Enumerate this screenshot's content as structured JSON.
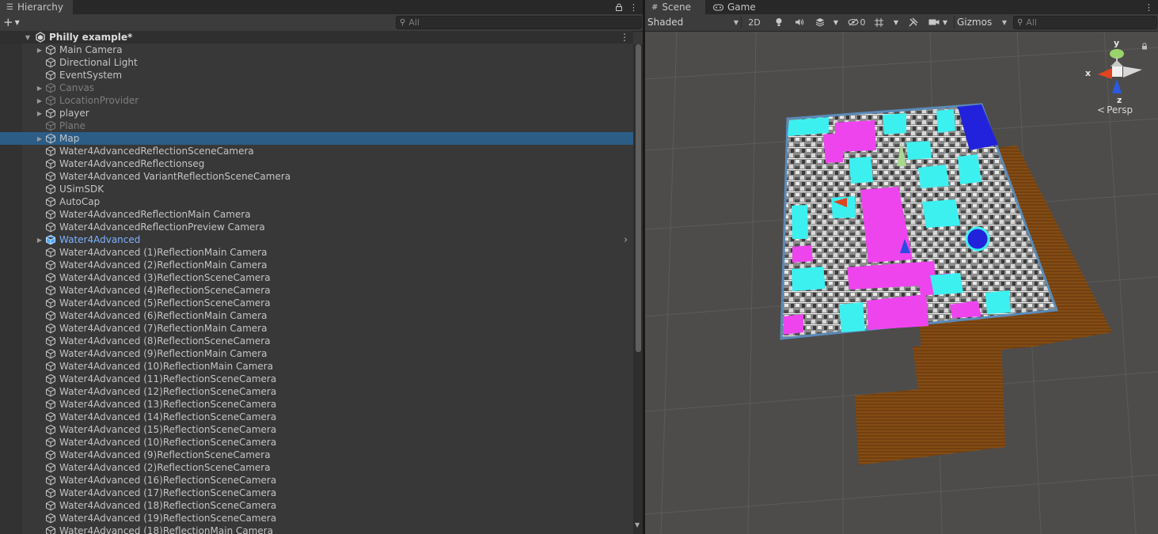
{
  "hierarchy": {
    "tab_title": "Hierarchy",
    "search_placeholder": "All",
    "scene_name": "Philly example*",
    "items": [
      {
        "label": "Main Camera",
        "fold": true,
        "state": "normal"
      },
      {
        "label": "Directional Light",
        "fold": false,
        "state": "normal"
      },
      {
        "label": "EventSystem",
        "fold": false,
        "state": "normal"
      },
      {
        "label": "Canvas",
        "fold": true,
        "state": "dim"
      },
      {
        "label": "LocationProvider",
        "fold": true,
        "state": "dim"
      },
      {
        "label": "player",
        "fold": true,
        "state": "normal"
      },
      {
        "label": "Plane",
        "fold": false,
        "state": "dim"
      },
      {
        "label": "Map",
        "fold": true,
        "state": "selected"
      },
      {
        "label": "Water4AdvancedReflectionSceneCamera",
        "fold": false,
        "state": "normal"
      },
      {
        "label": "Water4AdvancedReflectionseg",
        "fold": false,
        "state": "normal"
      },
      {
        "label": "Water4Advanced VariantReflectionSceneCamera",
        "fold": false,
        "state": "normal"
      },
      {
        "label": "USimSDK",
        "fold": false,
        "state": "normal"
      },
      {
        "label": "AutoCap",
        "fold": false,
        "state": "normal"
      },
      {
        "label": "Water4AdvancedReflectionMain Camera",
        "fold": false,
        "state": "normal"
      },
      {
        "label": "Water4AdvancedReflectionPreview Camera",
        "fold": false,
        "state": "normal"
      },
      {
        "label": "Water4Advanced",
        "fold": true,
        "state": "prefab"
      },
      {
        "label": "Water4Advanced (1)ReflectionMain Camera",
        "fold": false,
        "state": "normal"
      },
      {
        "label": "Water4Advanced (2)ReflectionMain Camera",
        "fold": false,
        "state": "normal"
      },
      {
        "label": "Water4Advanced (3)ReflectionSceneCamera",
        "fold": false,
        "state": "normal"
      },
      {
        "label": "Water4Advanced (4)ReflectionSceneCamera",
        "fold": false,
        "state": "normal"
      },
      {
        "label": "Water4Advanced (5)ReflectionSceneCamera",
        "fold": false,
        "state": "normal"
      },
      {
        "label": "Water4Advanced (6)ReflectionMain Camera",
        "fold": false,
        "state": "normal"
      },
      {
        "label": "Water4Advanced (7)ReflectionMain Camera",
        "fold": false,
        "state": "normal"
      },
      {
        "label": "Water4Advanced (8)ReflectionSceneCamera",
        "fold": false,
        "state": "normal"
      },
      {
        "label": "Water4Advanced (9)ReflectionMain Camera",
        "fold": false,
        "state": "normal"
      },
      {
        "label": "Water4Advanced (10)ReflectionMain Camera",
        "fold": false,
        "state": "normal"
      },
      {
        "label": "Water4Advanced (11)ReflectionSceneCamera",
        "fold": false,
        "state": "normal"
      },
      {
        "label": "Water4Advanced (12)ReflectionSceneCamera",
        "fold": false,
        "state": "normal"
      },
      {
        "label": "Water4Advanced (13)ReflectionSceneCamera",
        "fold": false,
        "state": "normal"
      },
      {
        "label": "Water4Advanced (14)ReflectionSceneCamera",
        "fold": false,
        "state": "normal"
      },
      {
        "label": "Water4Advanced (15)ReflectionSceneCamera",
        "fold": false,
        "state": "normal"
      },
      {
        "label": "Water4Advanced (10)ReflectionSceneCamera",
        "fold": false,
        "state": "normal"
      },
      {
        "label": "Water4Advanced (9)ReflectionSceneCamera",
        "fold": false,
        "state": "normal"
      },
      {
        "label": "Water4Advanced (2)ReflectionSceneCamera",
        "fold": false,
        "state": "normal"
      },
      {
        "label": "Water4Advanced (16)ReflectionSceneCamera",
        "fold": false,
        "state": "normal"
      },
      {
        "label": "Water4Advanced (17)ReflectionSceneCamera",
        "fold": false,
        "state": "normal"
      },
      {
        "label": "Water4Advanced (18)ReflectionSceneCamera",
        "fold": false,
        "state": "normal"
      },
      {
        "label": "Water4Advanced (19)ReflectionSceneCamera",
        "fold": false,
        "state": "normal"
      },
      {
        "label": "Water4Advanced (18)ReflectionMain Camera",
        "fold": false,
        "state": "normal"
      }
    ]
  },
  "scene": {
    "tabs": [
      {
        "label": "Scene",
        "icon": "grid-icon"
      },
      {
        "label": "Game",
        "icon": "gamepad-icon"
      }
    ],
    "shading_mode": "Shaded",
    "mode_2d": "2D",
    "hidden_count": "0",
    "gizmos_label": "Gizmos",
    "search_placeholder": "All",
    "axis_labels": {
      "y": "y",
      "x": "x",
      "z": "z"
    },
    "projection_label": "Persp"
  },
  "colors": {
    "selection": "#2c5d87",
    "prefab_text": "#7fb2ff",
    "cyan_buildings": "#3cf0f0",
    "magenta_areas": "#ee44ee",
    "water_blue": "#2222dd",
    "terrain_brown": "#7a4410"
  }
}
